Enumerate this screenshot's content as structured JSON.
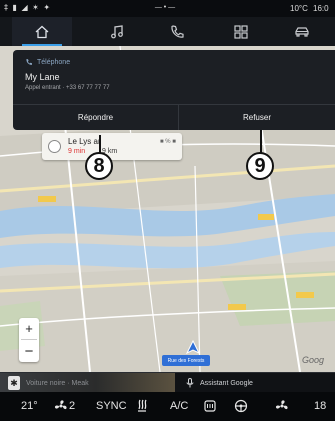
{
  "status_bar": {
    "left_icons": "‡ ▮ ◢ ✶ ✦",
    "center": "— • —",
    "temperature": "10°C",
    "time": "16:0"
  },
  "nav": {
    "tabs": [
      {
        "name": "home",
        "icon": "home-icon",
        "active": true
      },
      {
        "name": "music",
        "icon": "music-note-icon",
        "active": false
      },
      {
        "name": "phone",
        "icon": "phone-icon",
        "active": false
      },
      {
        "name": "apps",
        "icon": "apps-grid-icon",
        "active": false
      },
      {
        "name": "vehicle",
        "icon": "car-icon",
        "active": false
      }
    ]
  },
  "call": {
    "source": "Téléphone",
    "caller": "My Lane",
    "info": "Appel entrant · +33 67 77 77 77",
    "answer_label": "Répondre",
    "decline_label": "Refuser"
  },
  "route": {
    "destination": "Le Lys   ar",
    "eta": "9 min",
    "distance": "9 km",
    "signal": "■ % ■"
  },
  "callouts": {
    "answer_number": "8",
    "decline_number": "9"
  },
  "map": {
    "zoom_in": "+",
    "zoom_out": "−",
    "place_button": "Rue des Forests",
    "attribution": "Goog"
  },
  "media": {
    "source_icon": "bluetooth-icon",
    "text": "Voiture noire · Meak",
    "assistant_label": "Assistant Google"
  },
  "climate": {
    "left_temp": "21°",
    "fan_speed": "2",
    "sync_label": "SYNC",
    "ac_label": "A/C",
    "right_temp": "18"
  },
  "colors": {
    "accent": "#3a9ee8",
    "map_river": "#a9c9e6",
    "eta_red": "#d33333"
  }
}
